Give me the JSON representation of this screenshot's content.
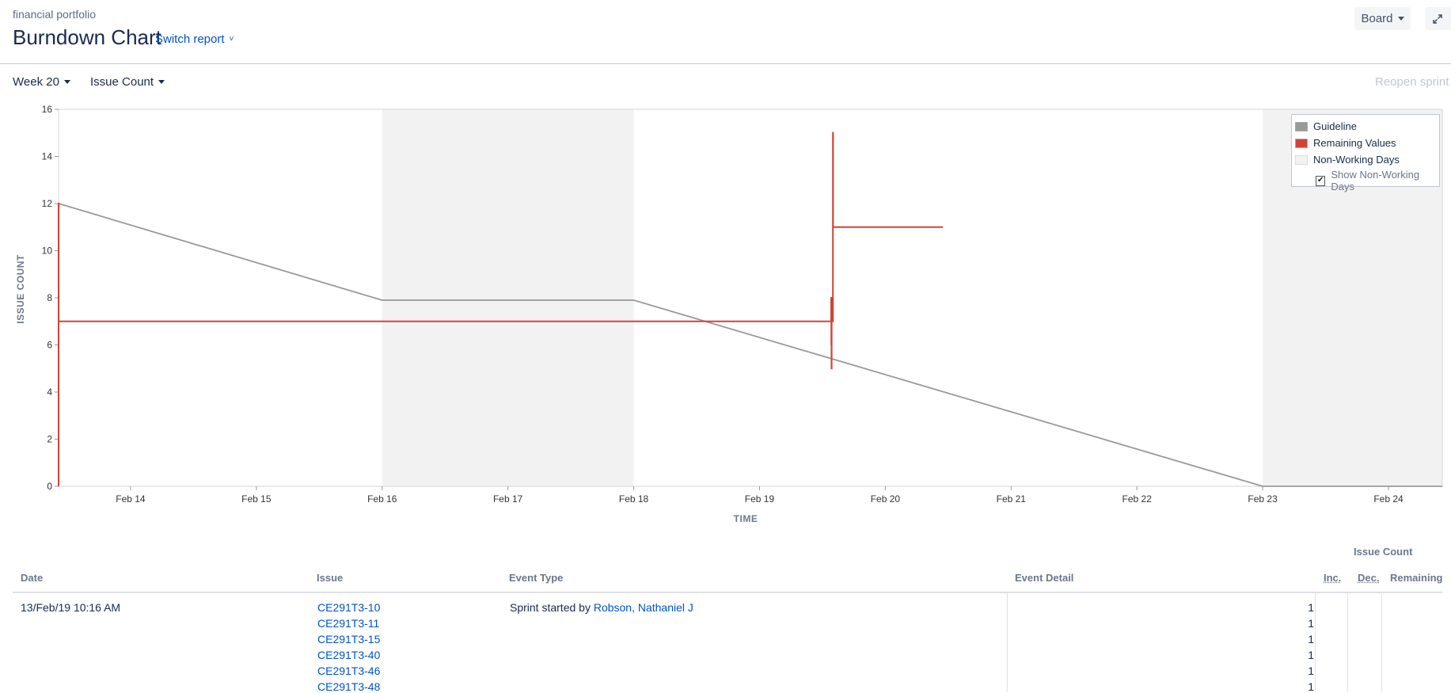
{
  "header": {
    "project_name": "financial portfolio",
    "title": "Burndown Chart",
    "switch_report": "Switch report",
    "board_button": "Board",
    "expand_icon": "expand-icon"
  },
  "toolbar": {
    "sprint_select": "Week 20",
    "estimation_select": "Issue Count",
    "reopen_sprint": "Reopen sprint"
  },
  "colors": {
    "guideline": "#999999",
    "remaining": "#d04437",
    "non_working": "#f2f2f2",
    "link": "#0052cc"
  },
  "chart_data": {
    "type": "line",
    "xlabel": "TIME",
    "ylabel": "ISSUE COUNT",
    "x_ticks": [
      "Feb 14",
      "Feb 15",
      "Feb 16",
      "Feb 17",
      "Feb 18",
      "Feb 19",
      "Feb 20",
      "Feb 21",
      "Feb 22",
      "Feb 23",
      "Feb 24"
    ],
    "xlim": [
      "2019-02-13 10:16",
      "2019-02-24 10:16"
    ],
    "ylim": [
      0,
      16
    ],
    "y_ticks": [
      0,
      2,
      4,
      6,
      8,
      10,
      12,
      14,
      16
    ],
    "grid": false,
    "legend_position": "top-right",
    "legend": [
      "Guideline",
      "Remaining Values",
      "Non-Working Days"
    ],
    "legend_option": "Show Non-Working Days",
    "legend_option_checked": true,
    "non_working_periods": [
      [
        "2019-02-16 00:00",
        "2019-02-18 00:00"
      ],
      [
        "2019-02-23 00:00",
        "2019-02-24 10:16"
      ]
    ],
    "series": [
      {
        "name": "Guideline",
        "points": [
          [
            "2019-02-13 10:16",
            12
          ],
          [
            "2019-02-16 00:00",
            7.9
          ],
          [
            "2019-02-18 00:00",
            7.9
          ],
          [
            "2019-02-23 00:00",
            0
          ],
          [
            "2019-02-24 10:16",
            0
          ]
        ]
      },
      {
        "name": "Remaining Values",
        "points": [
          [
            "2019-02-13 10:16",
            0
          ],
          [
            "2019-02-13 10:16",
            12
          ],
          [
            "2019-02-13 10:17",
            12
          ],
          [
            "2019-02-13 10:17",
            7
          ],
          [
            "2019-02-19 13:40",
            7
          ],
          [
            "2019-02-19 13:40",
            8
          ],
          [
            "2019-02-19 13:42",
            8
          ],
          [
            "2019-02-19 13:42",
            6
          ],
          [
            "2019-02-19 13:44",
            6
          ],
          [
            "2019-02-19 13:44",
            5
          ],
          [
            "2019-02-19 13:46",
            5
          ],
          [
            "2019-02-19 13:46",
            7
          ],
          [
            "2019-02-19 14:00",
            7
          ],
          [
            "2019-02-19 14:00",
            15
          ],
          [
            "2019-02-19 14:02",
            15
          ],
          [
            "2019-02-19 14:02",
            11
          ],
          [
            "2019-02-20 11:00",
            11
          ]
        ]
      }
    ]
  },
  "table": {
    "group_header": "Issue Count",
    "headers": {
      "date": "Date",
      "issue": "Issue",
      "event_type": "Event Type",
      "event_detail": "Event Detail",
      "inc": "Inc.",
      "dec": "Dec.",
      "remaining": "Remaining"
    },
    "rows": [
      {
        "date": "13/Feb/19 10:16 AM",
        "issues": [
          "CE291T3-10",
          "CE291T3-11",
          "CE291T3-15",
          "CE291T3-40",
          "CE291T3-46",
          "CE291T3-48"
        ],
        "event_prefix": "Sprint started by",
        "event_user": "Robson, Nathaniel J",
        "event_detail": "",
        "inc": [
          "1",
          "1",
          "1",
          "1",
          "1",
          "1"
        ],
        "dec": "",
        "remaining": ""
      }
    ]
  }
}
